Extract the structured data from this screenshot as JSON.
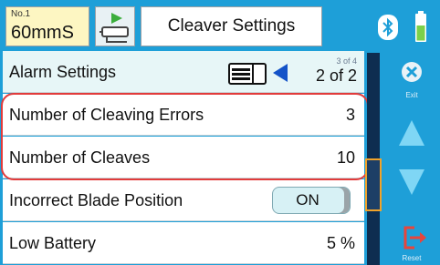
{
  "header": {
    "badge_no": "No.1",
    "badge_value": "60mmS",
    "title": "Cleaver Settings"
  },
  "icons": {
    "mode": "play-cleaver-icon",
    "bluetooth": "bluetooth-icon",
    "battery": "battery-icon",
    "list": "list-icon",
    "prev": "triangle-left-icon",
    "exit": "close-circle-icon",
    "up": "triangle-up-icon",
    "down": "triangle-down-icon",
    "reset": "logout-icon"
  },
  "list": {
    "header_label": "Alarm Settings",
    "page_small": "3 of 4",
    "page_big": "2 of 2",
    "rows": [
      {
        "label": "Number of Cleaving Errors",
        "value": "3"
      },
      {
        "label": "Number of Cleaves",
        "value": "10"
      },
      {
        "label": "Incorrect Blade Position",
        "value": "ON"
      },
      {
        "label": "Low Battery",
        "value": "5 %"
      }
    ]
  },
  "side": {
    "exit_label": "Exit",
    "reset_label": "Reset"
  },
  "colors": {
    "background": "#1e9fd8",
    "highlight": "#e23b3b",
    "scroll_thumb_border": "#f0a32a",
    "accent_blue": "#1453c8",
    "reset_red": "#e8453c"
  }
}
